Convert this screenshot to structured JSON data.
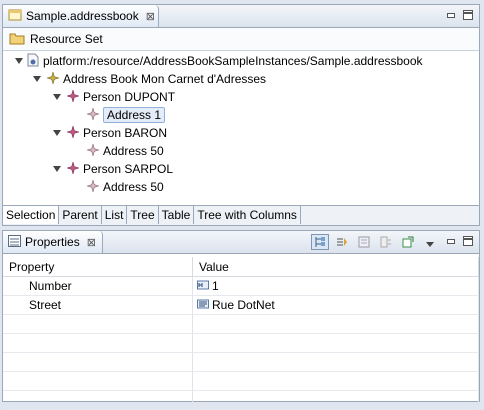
{
  "editor": {
    "tab_title": "Sample.addressbook",
    "close_glyph": "⊠",
    "resource_set_label": "Resource Set",
    "tree": [
      {
        "label": "platform:/resource/AddressBookSampleInstances/Sample.addressbook"
      },
      {
        "label": "Address Book Mon Carnet d'Adresses"
      },
      {
        "label": "Person DUPONT"
      },
      {
        "label": "Address 1"
      },
      {
        "label": "Person BARON"
      },
      {
        "label": "Address 50"
      },
      {
        "label": "Person SARPOL"
      },
      {
        "label": "Address 50"
      }
    ],
    "bottom_tabs": [
      "Selection",
      "Parent",
      "List",
      "Tree",
      "Table",
      "Tree with Columns"
    ]
  },
  "properties": {
    "tab_title": "Properties",
    "close_glyph": "⊠",
    "columns": [
      "Property",
      "Value"
    ],
    "rows": [
      {
        "property": "Number",
        "value": "1"
      },
      {
        "property": "Street",
        "value": "Rue DotNet"
      }
    ]
  },
  "colors": {
    "accent": "#8fb0d8",
    "person_icon": "#9a3c63",
    "address_icon": "#9a7a84"
  }
}
